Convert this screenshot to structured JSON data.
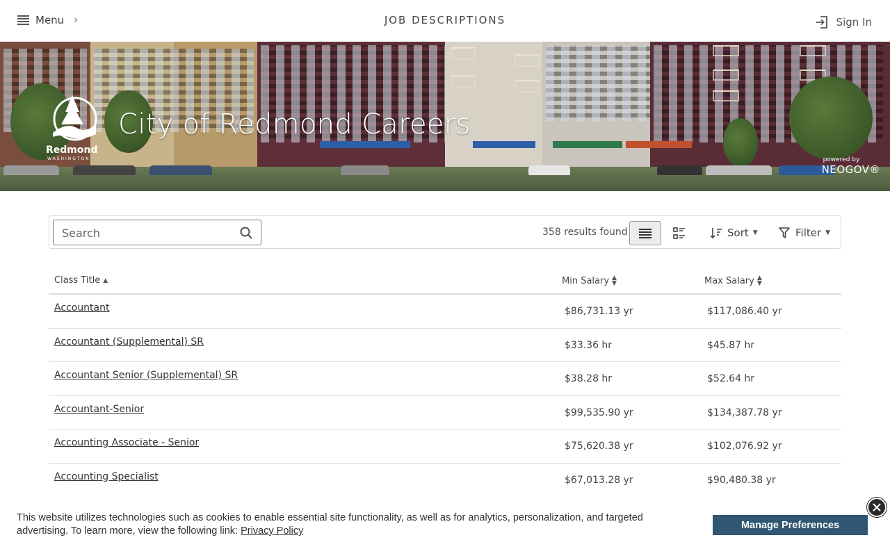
{
  "header": {
    "menu_label": "Menu",
    "title": "JOB DESCRIPTIONS",
    "sign_in": "Sign In"
  },
  "banner": {
    "title": "City of Redmond Careers",
    "logo_name": "Redmond",
    "logo_sub": "WASHINGTON",
    "powered_by": "powered by",
    "powered_brand": "NEOGOV®"
  },
  "toolbar": {
    "search_placeholder": "Search",
    "results": "358 results found",
    "sort_label": "Sort",
    "filter_label": "Filter"
  },
  "table": {
    "columns": [
      "Class Title",
      "Min Salary",
      "Max Salary"
    ],
    "rows": [
      {
        "title": "Accountant",
        "min": "$86,731.13 yr",
        "max": "$117,086.40 yr"
      },
      {
        "title": "Accountant (Supplemental) SR",
        "min": "$33.36 hr",
        "max": "$45.87 hr"
      },
      {
        "title": "Accountant Senior (Supplemental) SR",
        "min": "$38.28 hr",
        "max": "$52.64 hr"
      },
      {
        "title": "Accountant-Senior",
        "min": "$99,535.90 yr",
        "max": "$134,387.78 yr"
      },
      {
        "title": "Accounting Associate - Senior",
        "min": "$75,620.38 yr",
        "max": "$102,076.92 yr"
      },
      {
        "title": "Accounting Specialist",
        "min": "$67,013.28 yr",
        "max": "$90,480.38 yr"
      }
    ]
  },
  "cookie": {
    "text_before": "This website utilizes technologies such as cookies to enable essential site functionality, as well as for analytics, personalization, and targeted advertising. To learn more, view the following link: ",
    "link": "Privacy Policy",
    "button": "Manage Preferences"
  },
  "colors": {
    "accent": "#2f5672"
  }
}
